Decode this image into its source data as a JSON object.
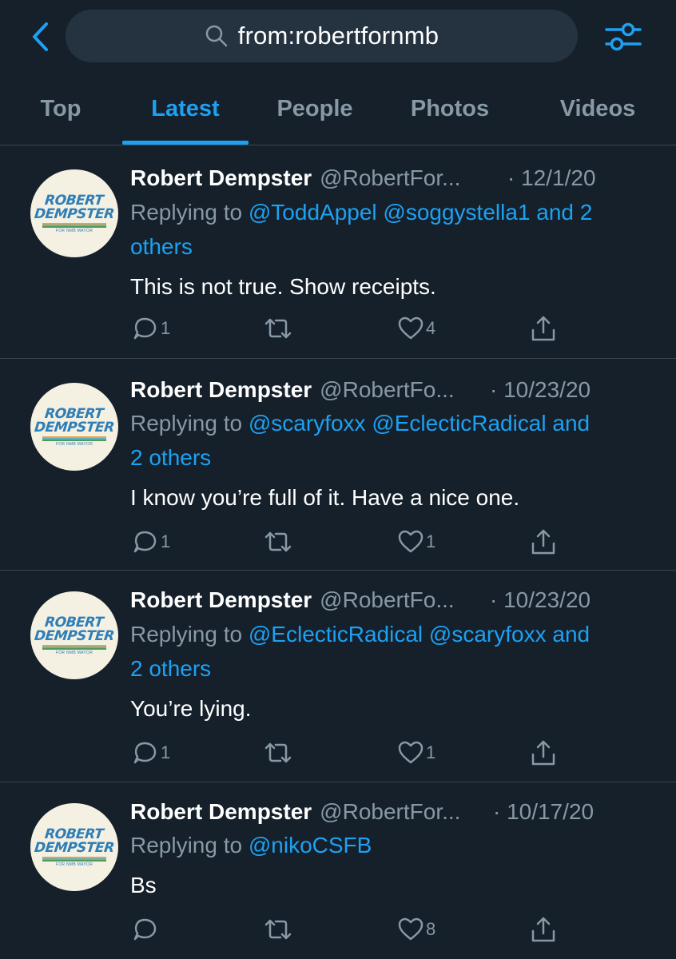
{
  "search": {
    "query": "from:robertfornmb"
  },
  "tabs": [
    "Top",
    "Latest",
    "People",
    "Photos",
    "Videos"
  ],
  "active_tab": "Latest",
  "colors": {
    "background": "#15202b",
    "accent": "#1da1f2",
    "muted": "#8899a6",
    "divider": "#38444d"
  },
  "avatar": {
    "line1": "ROBERT",
    "line2": "DEMPSTER",
    "tagline": "FOR NMB MAYOR"
  },
  "tweets": [
    {
      "name": "Robert Dempster",
      "handle": "@RobertFor...",
      "date": "· 12/1/20",
      "reply_prefix": "Replying to",
      "mentions": "@ToddAppel @soggystella1 and 2",
      "mentions_cont": "others",
      "text": "This is not true. Show receipts.",
      "replies": "1",
      "retweets": "",
      "likes": "4"
    },
    {
      "name": "Robert Dempster",
      "handle": "@RobertFo...",
      "date": "· 10/23/20",
      "reply_prefix": "Replying to",
      "mentions": "@scaryfoxx @EclecticRadical and",
      "mentions_cont": "2 others",
      "text": "I know you’re full of it. Have a nice one.",
      "replies": "1",
      "retweets": "",
      "likes": "1"
    },
    {
      "name": "Robert Dempster",
      "handle": "@RobertFo...",
      "date": "· 10/23/20",
      "reply_prefix": "Replying to",
      "mentions": "@EclecticRadical @scaryfoxx and",
      "mentions_cont": "2 others",
      "text": "You’re lying.",
      "replies": "1",
      "retweets": "",
      "likes": "1"
    },
    {
      "name": "Robert Dempster",
      "handle": "@RobertFor...",
      "date": "· 10/17/20",
      "reply_prefix": "Replying to",
      "mentions": "@nikoCSFB",
      "mentions_cont": "",
      "text": "Bs",
      "replies": "",
      "retweets": "",
      "likes": "8"
    }
  ]
}
